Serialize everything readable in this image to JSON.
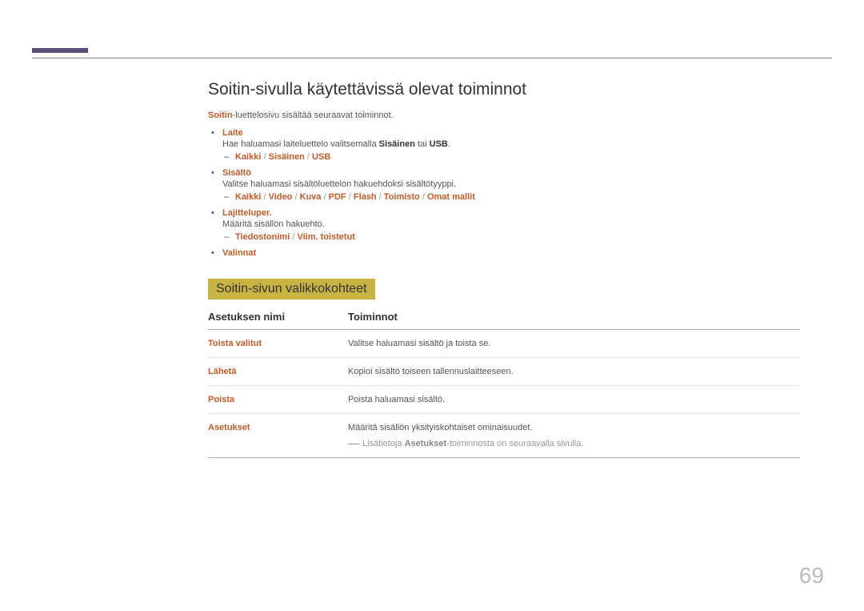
{
  "heading": "Soitin-sivulla käytettävissä olevat toiminnot",
  "intro": {
    "prefix": "Soitin",
    "suffix": "-luettelosivu sisältää seuraavat toiminnot."
  },
  "bullets": [
    {
      "title": "Laite",
      "desc_parts": [
        "Hae haluamasi laiteluettelo valitsemalla ",
        "Sisäinen",
        " tai ",
        "USB",
        "."
      ],
      "sub": [
        "Kaikki",
        "Sisäinen",
        "USB"
      ]
    },
    {
      "title": "Sisältö",
      "desc": "Valitse haluamasi sisältöluettelon hakuehdoksi sisältötyyppi.",
      "sub": [
        "Kaikki",
        "Video",
        "Kuva",
        "PDF",
        "Flash",
        "Toimisto",
        "Omat mallit"
      ]
    },
    {
      "title": "Lajitteluper.",
      "desc": "Määritä sisällön hakuehto.",
      "sub": [
        "Tiedostonimi",
        "Viim. toistetut"
      ]
    },
    {
      "title": "Valinnat"
    }
  ],
  "subheading": "Soitin-sivun valikkokohteet",
  "table": {
    "headers": [
      "Asetuksen nimi",
      "Toiminnot"
    ],
    "rows": [
      {
        "name": "Toista valitut",
        "desc": "Valitse haluamasi sisältö ja toista se."
      },
      {
        "name": "Lähetä",
        "desc": "Kopioi sisältö toiseen tallennuslaitteeseen."
      },
      {
        "name": "Poista",
        "desc": "Poista haluamasi sisältö."
      },
      {
        "name": "Asetukset",
        "desc": "Määritä sisällön yksityiskohtaiset ominaisuudet.",
        "note_parts": [
          "Lisätietoja ",
          "Asetukset",
          "-toiminnosta on seuraavalla sivulla."
        ]
      }
    ]
  },
  "page_number": "69"
}
